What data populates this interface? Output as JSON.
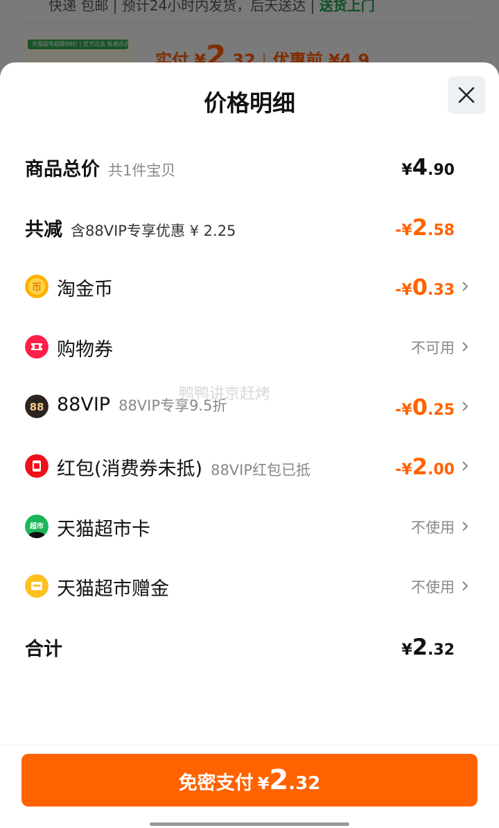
{
  "background": {
    "line1_text": "快递 包邮 | 预计24小时内发货，后天送达 | ",
    "line1_link": "送货上门",
    "thumb_strip": "天猫超市超级88价 | 官方正品 极速送达",
    "price_prefix": "实付 ¥",
    "price_int": "2",
    "price_dec": ".32",
    "price_before_label": "优惠前 ¥4.9"
  },
  "sheet": {
    "title": "价格明细",
    "close_icon": "close-icon"
  },
  "rows": {
    "total": {
      "label": "商品总价",
      "sub": "共1件宝贝",
      "currency": "¥",
      "int": "4",
      "dec": ".90"
    },
    "reduce": {
      "label": "共减",
      "sub": "含88VIP专享优惠 ¥ 2.25",
      "sign": "-¥",
      "int": "2",
      "dec": ".58"
    },
    "coin": {
      "label": "淘金币",
      "sign": "-¥",
      "int": "0",
      "dec": ".33",
      "icon": "coin-icon"
    },
    "voucher": {
      "label": "购物券",
      "status": "不可用",
      "icon": "ticket-icon"
    },
    "vip": {
      "label": "88VIP",
      "sub": "88VIP专享9.5折",
      "sign": "-¥",
      "int": "0",
      "dec": ".25",
      "icon_text": "88",
      "icon": "vip-88-icon"
    },
    "redpacket": {
      "label": "红包(消费券未抵)",
      "sub": "88VIP红包已抵",
      "sign": "-¥",
      "int": "2",
      "dec": ".00",
      "icon": "red-packet-icon"
    },
    "card": {
      "label": "天猫超市卡",
      "status": "不使用",
      "icon_text": "超市",
      "icon": "supermarket-card-icon"
    },
    "gift": {
      "label": "天猫超市赠金",
      "status": "不使用",
      "icon": "gift-gold-icon"
    },
    "sum": {
      "label": "合计",
      "currency": "¥",
      "int": "2",
      "dec": ".32"
    }
  },
  "pay_button": {
    "label": "免密支付",
    "currency": "¥",
    "int": "2",
    "dec": ".32"
  },
  "watermark": "鸭鸭讲京赶烤",
  "colors": {
    "accent": "#ff6200",
    "green": "#1f9e4f",
    "muted": "#888888"
  }
}
